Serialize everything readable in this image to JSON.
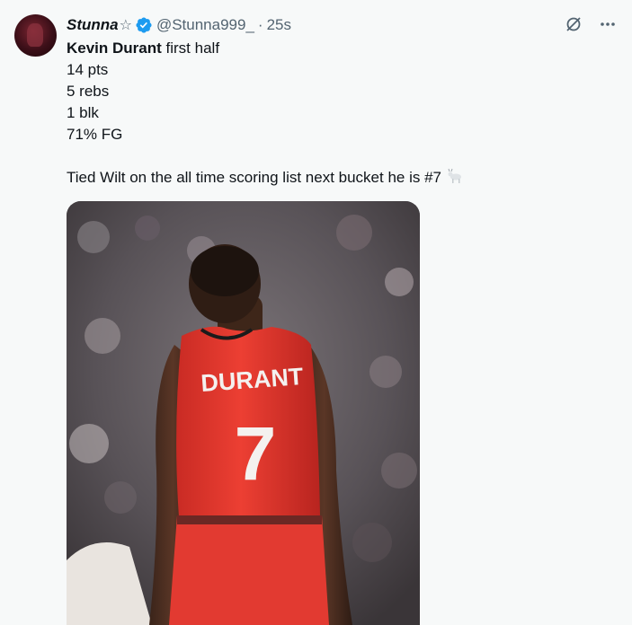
{
  "tweet": {
    "author_name": "Stunna",
    "author_badge": "☆",
    "handle": "@Stunna999_",
    "separator": "·",
    "time": "25s",
    "lines": {
      "l1_bold": "Kevin Durant",
      "l1_rest": " first half",
      "l2": "14 pts",
      "l3": "5 rebs",
      "l4": "1 blk",
      "l5": "71% FG",
      "l6": "Tied Wilt on the all time scoring list next bucket he is #7"
    },
    "emoji": "goat",
    "jersey_name": "DURANT",
    "jersey_number": "7"
  },
  "icons": {
    "verified": "verified-badge-icon",
    "grok": "grok-icon",
    "more": "more-icon"
  },
  "colors": {
    "verified": "#1d9bf0",
    "secondary_text": "#536471",
    "jersey": "#e8392f"
  }
}
